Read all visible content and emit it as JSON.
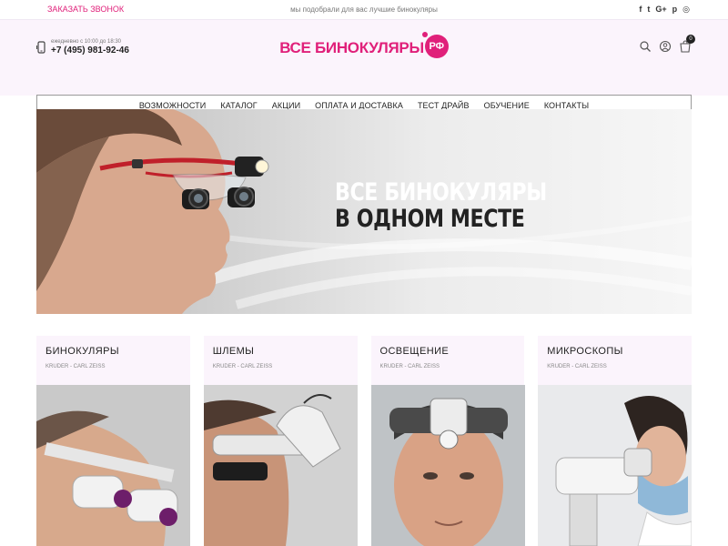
{
  "topbar": {
    "call_label": "ЗАКАЗАТЬ ЗВОНОК",
    "tagline": "мы подобрали для вас лучшие бинокуляры",
    "social": [
      {
        "icon": "facebook-icon",
        "glyph": "f"
      },
      {
        "icon": "twitter-icon",
        "glyph": "t"
      },
      {
        "icon": "google-plus-icon",
        "glyph": "G+"
      },
      {
        "icon": "pinterest-icon",
        "glyph": "p"
      },
      {
        "icon": "instagram-icon",
        "glyph": "◎"
      }
    ]
  },
  "header": {
    "hours": "ежедневно с 10:00 до 18:30",
    "phone": "+7 (495) 981-92-46",
    "logo_main": "ВСЕ БИНОКУЛЯРЫ",
    "logo_rf": "РФ",
    "cart_count": "0"
  },
  "nav": {
    "items": [
      "ВОЗМОЖНОСТИ",
      "КАТАЛОГ",
      "АКЦИИ",
      "ОПЛАТА И ДОСТАВКА",
      "ТЕСТ ДРАЙВ",
      "ОБУЧЕНИЕ",
      "КОНТАКТЫ"
    ]
  },
  "hero": {
    "line1": "ВСЕ БИНОКУЛЯРЫ",
    "line2": "В ОДНОМ МЕСТЕ"
  },
  "categories": [
    {
      "title": "БИНОКУЛЯРЫ",
      "sub": "KRUDER - CARL ZEISS"
    },
    {
      "title": "ШЛЕМЫ",
      "sub": "KRUDER - CARL ZEISS"
    },
    {
      "title": "ОСВЕЩЕНИЕ",
      "sub": "KRUDER - CARL ZEISS"
    },
    {
      "title": "МИКРОСКОПЫ",
      "sub": "KRUDER - CARL ZEISS"
    }
  ],
  "colors": {
    "accent": "#e0207a",
    "header_bg": "#fbf4fc"
  }
}
